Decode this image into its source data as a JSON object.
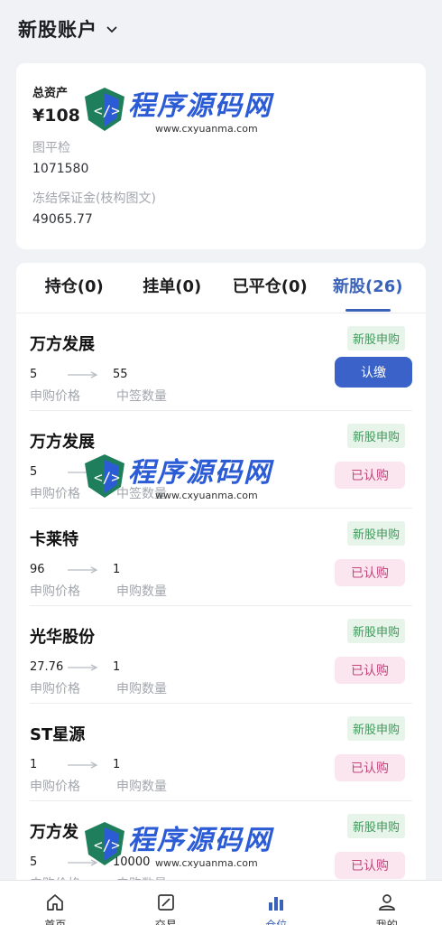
{
  "header": {
    "title": "新股账户"
  },
  "asset": {
    "total_label": "总资产",
    "total_value": "¥108",
    "balance_label": "图平检",
    "balance_value": "1071580",
    "frozen_label": "冻结保证金(枝构图文)",
    "frozen_value": "49065.77"
  },
  "tabs": [
    "持仓(0)",
    "挂单(0)",
    "已平仓(0)",
    "新股(26)"
  ],
  "items": [
    {
      "name": "万方发展",
      "v1": "5",
      "v2": "55",
      "l1": "申购价格",
      "l2": "中签数量",
      "tag": "新股申购",
      "action": "认缴",
      "action_type": "primary"
    },
    {
      "name": "万方发展",
      "v1": "5",
      "v2": "",
      "l1": "申购价格",
      "l2": "中签数量",
      "tag": "新股申购",
      "action": "已认购",
      "action_type": "done"
    },
    {
      "name": "卡莱特",
      "v1": "96",
      "v2": "1",
      "l1": "申购价格",
      "l2": "申购数量",
      "tag": "新股申购",
      "action": "已认购",
      "action_type": "done"
    },
    {
      "name": "光华股份",
      "v1": "27.76",
      "v2": "1",
      "l1": "申购价格",
      "l2": "申购数量",
      "tag": "新股申购",
      "action": "已认购",
      "action_type": "done"
    },
    {
      "name": "ST星源",
      "v1": "1",
      "v2": "1",
      "l1": "申购价格",
      "l2": "申购数量",
      "tag": "新股申购",
      "action": "已认购",
      "action_type": "done"
    },
    {
      "name": "万方发",
      "v1": "5",
      "v2": "10000",
      "l1": "申购价格",
      "l2": "申购数量",
      "tag": "新股申购",
      "action": "已认购",
      "action_type": "done"
    }
  ],
  "nav": [
    {
      "label": "首页",
      "icon": "home-icon"
    },
    {
      "label": "交易",
      "icon": "trade-chart-icon"
    },
    {
      "label": "仓位",
      "icon": "bar-chart-icon"
    },
    {
      "label": "我的",
      "icon": "user-icon"
    }
  ],
  "watermark": {
    "text": "程序源码网",
    "url": "www.cxyuanma.com"
  },
  "colors": {
    "accent": "#3a62b8",
    "tag_bg": "#e6f4ea",
    "tag_fg": "#3f9a5a",
    "done_bg": "#fbe6ef",
    "done_fg": "#c4457c"
  }
}
